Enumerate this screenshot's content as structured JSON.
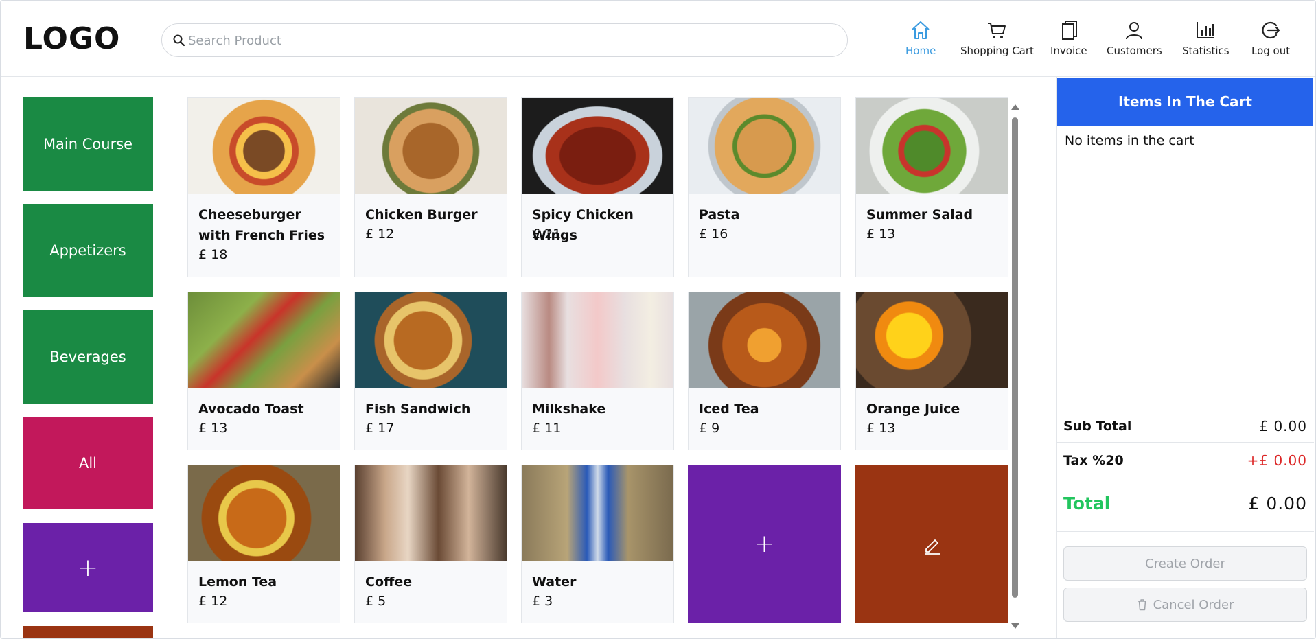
{
  "header": {
    "logo": "LOGO",
    "search_placeholder": "Search Product",
    "nav": [
      {
        "label": "Home",
        "icon": "home-icon",
        "active": true
      },
      {
        "label": "Shopping Cart",
        "icon": "cart-icon"
      },
      {
        "label": "Invoice",
        "icon": "invoice-icon"
      },
      {
        "label": "Customers",
        "icon": "user-icon"
      },
      {
        "label": "Statistics",
        "icon": "bar-chart-icon"
      },
      {
        "label": "Log out",
        "icon": "logout-icon"
      }
    ]
  },
  "categories": [
    {
      "label": "Main Course",
      "color": "#1a8a44"
    },
    {
      "label": "Appetizers",
      "color": "#1a8a44"
    },
    {
      "label": "Beverages",
      "color": "#1a8a44"
    },
    {
      "label": "All",
      "color": "#c2185b"
    },
    {
      "label": "+",
      "color": "#6b21a8"
    }
  ],
  "products": [
    {
      "name": "Cheeseburger with French Fries",
      "price": "£ 18"
    },
    {
      "name": "Chicken Burger",
      "price": "£ 12"
    },
    {
      "name": "Spicy Chicken Wings",
      "price": "£ 21"
    },
    {
      "name": "Pasta",
      "price": "£ 16"
    },
    {
      "name": "Summer Salad",
      "price": "£ 13"
    },
    {
      "name": "Avocado Toast",
      "price": "£ 13"
    },
    {
      "name": "Fish Sandwich",
      "price": "£ 17"
    },
    {
      "name": "Milkshake",
      "price": "£ 11"
    },
    {
      "name": "Iced Tea",
      "price": "£ 9"
    },
    {
      "name": "Orange Juice",
      "price": "£ 13"
    },
    {
      "name": "Lemon Tea",
      "price": "£ 12"
    },
    {
      "name": "Coffee",
      "price": "£ 5"
    },
    {
      "name": "Water",
      "price": "£ 3"
    }
  ],
  "tiles": {
    "add_symbol": "+",
    "add_color": "#6b21a8",
    "edit_icon": "pencil-icon",
    "edit_color": "#9a3412"
  },
  "cart": {
    "title": "Items In The Cart",
    "empty_text": "No items in the cart",
    "subtotal_label": "Sub Total",
    "subtotal_value": "£ 0.00",
    "tax_label": "Tax %20",
    "tax_value": "+£ 0.00",
    "total_label": "Total",
    "total_value": "£ 0.00",
    "create_label": "Create Order",
    "cancel_label": "Cancel Order",
    "accent": "#2563eb",
    "total_color": "#22c55e",
    "tax_color": "#dc2626"
  }
}
